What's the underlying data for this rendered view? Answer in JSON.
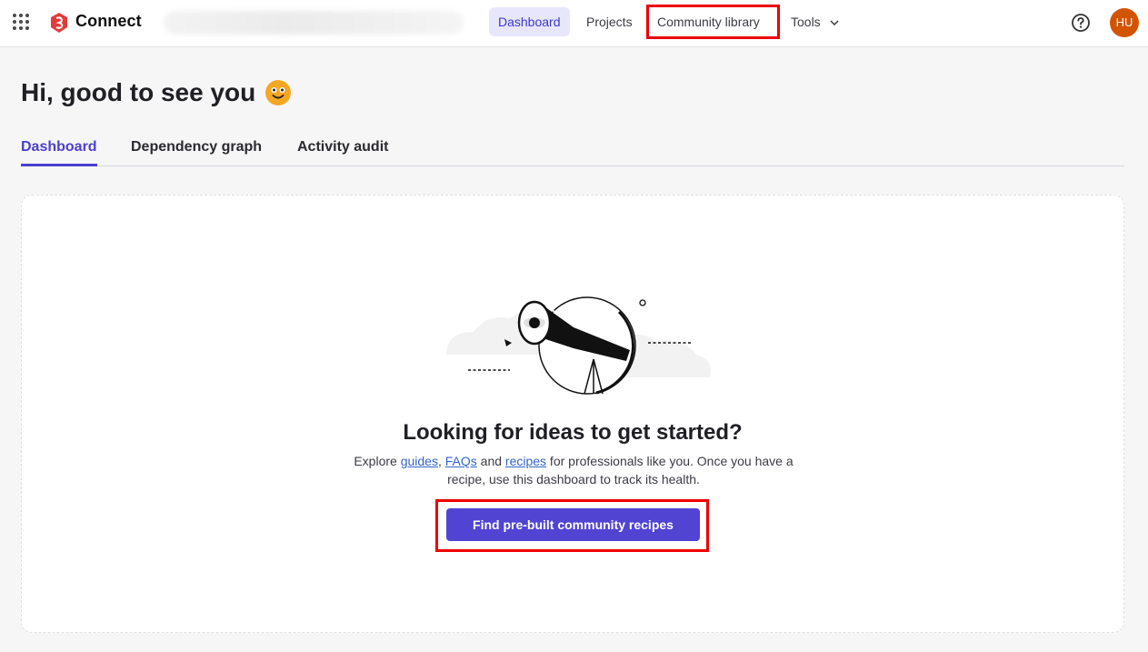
{
  "topbar": {
    "brand": "Connect",
    "nav": [
      {
        "label": "Dashboard",
        "active": true
      },
      {
        "label": "Projects",
        "active": false
      },
      {
        "label": "Community library",
        "active": false
      },
      {
        "label": "Tools",
        "active": false
      }
    ],
    "help_icon": "question-circle-icon",
    "avatar_initials": "HU",
    "avatar_color": "#d35400"
  },
  "page": {
    "greeting": "Hi, good to see you",
    "greeting_emoji": "smiley-icon"
  },
  "tabs": [
    {
      "label": "Dashboard",
      "active": true
    },
    {
      "label": "Dependency graph",
      "active": false
    },
    {
      "label": "Activity audit",
      "active": false
    }
  ],
  "empty_state": {
    "title": "Looking for ideas to get started?",
    "desc_prefix": "Explore ",
    "link_guides": "guides",
    "sep1": ", ",
    "link_faqs": "FAQs",
    "sep2": " and ",
    "link_recipes": "recipes",
    "desc_suffix": " for professionals like you. Once you have a recipe, use this dashboard to track its health.",
    "cta_label": "Find pre-built community recipes"
  },
  "colors": {
    "accent": "#5144d3",
    "active_nav_bg": "#e8e6fb",
    "link": "#3465c9",
    "highlight": "#ee0000"
  }
}
